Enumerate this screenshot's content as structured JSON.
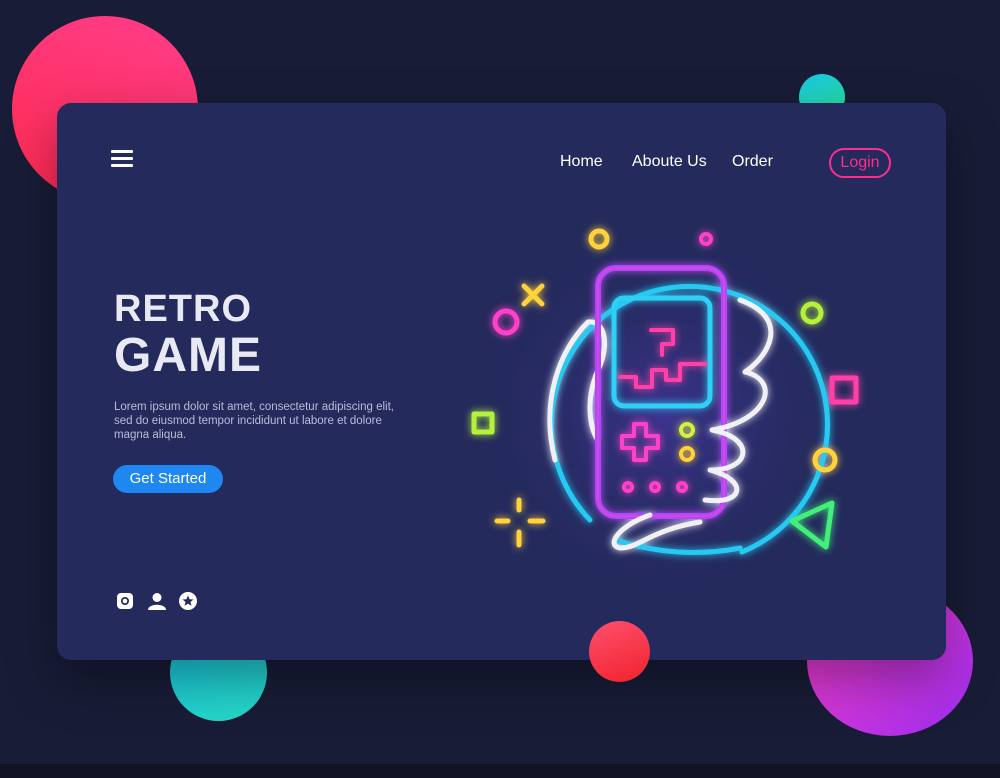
{
  "header": {
    "nav": [
      "Home",
      "Aboute Us",
      "Order"
    ],
    "login": "Login"
  },
  "hero": {
    "title_line1": "RETRO",
    "title_line2": "GAME",
    "description": "Lorem ipsum dolor sit amet, consectetur adipiscing elit, sed do eiusmod tempor incididunt ut labore et dolore magna aliqua.",
    "cta": "Get Started"
  },
  "social_icons": [
    "instagram-icon",
    "user-icon",
    "star-icon"
  ],
  "colors": {
    "background": "#181c36",
    "card": "#242a5c",
    "accent_pink": "#ff2c8f",
    "cta_blue": "#1f87f2"
  }
}
